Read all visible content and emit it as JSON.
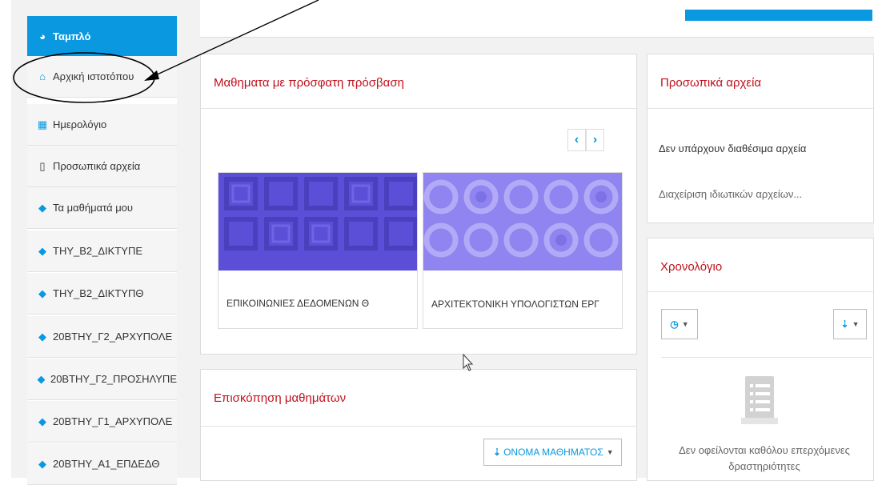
{
  "sidebar": {
    "items": [
      {
        "label": "Ταμπλό",
        "icon": "dashboard-icon",
        "active": true
      },
      {
        "label": "Αρχική ιστοτόπου",
        "icon": "home-icon"
      },
      {
        "label": "Ημερολόγιο",
        "icon": "calendar-icon"
      },
      {
        "label": "Προσωπικά αρχεία",
        "icon": "file-icon"
      },
      {
        "label": "Τα μαθήματά μου",
        "icon": "graduation-cap-icon"
      },
      {
        "label": "ΤΗΥ_Β2_ΔΙΚΤΥΠΕ",
        "icon": "graduation-cap-icon"
      },
      {
        "label": "ΤΗΥ_Β2_ΔΙΚΤΥΠΘ",
        "icon": "graduation-cap-icon"
      },
      {
        "label": "20ΒΤΗΥ_Γ2_ΑΡΧΥΠΟΛΕ",
        "icon": "graduation-cap-icon"
      },
      {
        "label": "20ΒΤΗΥ_Γ2_ΠΡΟΣΗΛΥΠΕ",
        "icon": "graduation-cap-icon"
      },
      {
        "label": "20ΒΤΗΥ_Γ1_ΑΡΧΥΠΟΛΕ",
        "icon": "graduation-cap-icon"
      },
      {
        "label": "20ΒΤΗΥ_Α1_ΕΠΔΕΔΘ",
        "icon": "graduation-cap-icon"
      }
    ]
  },
  "recent": {
    "title": "Μαθηματα με πρόσφατη πρόσβαση",
    "prev_glyph": "‹",
    "next_glyph": "›",
    "courses": [
      {
        "name": "ΕΠΙΚΟΙΝΩΝΙΕΣ ΔΕΔΟΜΕΝΩΝ Θ",
        "pattern": "squares",
        "color": "#5a4fd6"
      },
      {
        "name": "ΑΡΧΙΤΕΚΤΟΝΙΚΗ ΥΠΟΛΟΓΙΣΤΩΝ ΕΡΓ",
        "pattern": "circles",
        "color": "#8f84f0"
      }
    ]
  },
  "overview": {
    "title": "Επισκόπηση μαθημάτων",
    "sort_label": "ΟΝΟΜΑ ΜΑΘΗΜΑΤΟΣ"
  },
  "private_files": {
    "title": "Προσωπικά αρχεία",
    "empty_text": "Δεν υπάρχουν διαθέσιμα αρχεία",
    "manage_link": "Διαχείριση ιδιωτικών αρχείων..."
  },
  "timeline": {
    "title": "Χρονολόγιο",
    "empty_line1": "Δεν οφείλονται καθόλου επερχόμενες",
    "empty_line2": "δραστηριότητες"
  },
  "colors": {
    "accent": "#0a98e0",
    "title_red": "#c0121d"
  }
}
